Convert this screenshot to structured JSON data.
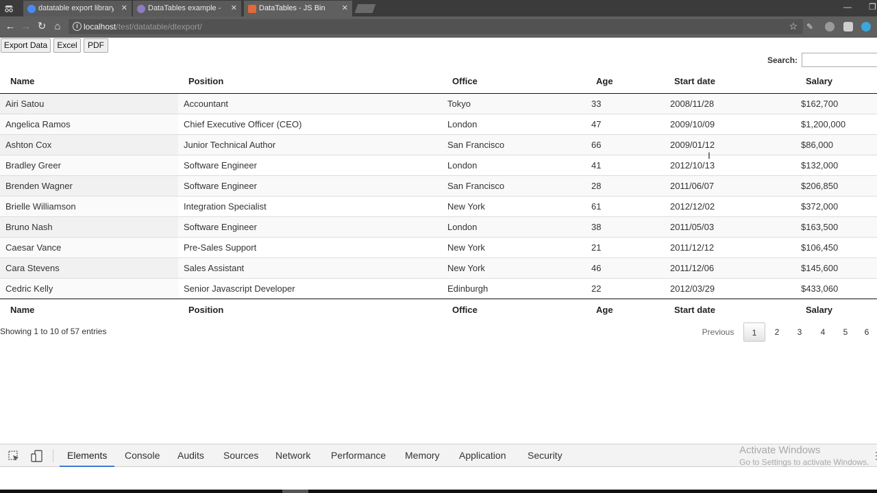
{
  "browser": {
    "tabs": [
      {
        "title": "datatable export library",
        "favicon_color": "#4a8af4"
      },
      {
        "title": "DataTables example - File",
        "favicon_color": "#8e7cc3"
      },
      {
        "title": "DataTables - JS Bin",
        "favicon_color": "#e2693a"
      }
    ],
    "close_glyph": "✕",
    "url_host": "localhost",
    "url_path": "/test/datatable/dtexport/"
  },
  "export_buttons": {
    "export_data": "Export Data",
    "excel": "Excel",
    "pdf": "PDF"
  },
  "search": {
    "label": "Search:",
    "value": ""
  },
  "table": {
    "columns": [
      "Name",
      "Position",
      "Office",
      "Age",
      "Start date",
      "Salary"
    ],
    "rows": [
      [
        "Airi Satou",
        "Accountant",
        "Tokyo",
        "33",
        "2008/11/28",
        "$162,700"
      ],
      [
        "Angelica Ramos",
        "Chief Executive Officer (CEO)",
        "London",
        "47",
        "2009/10/09",
        "$1,200,000"
      ],
      [
        "Ashton Cox",
        "Junior Technical Author",
        "San Francisco",
        "66",
        "2009/01/12",
        "$86,000"
      ],
      [
        "Bradley Greer",
        "Software Engineer",
        "London",
        "41",
        "2012/10/13",
        "$132,000"
      ],
      [
        "Brenden Wagner",
        "Software Engineer",
        "San Francisco",
        "28",
        "2011/06/07",
        "$206,850"
      ],
      [
        "Brielle Williamson",
        "Integration Specialist",
        "New York",
        "61",
        "2012/12/02",
        "$372,000"
      ],
      [
        "Bruno Nash",
        "Software Engineer",
        "London",
        "38",
        "2011/05/03",
        "$163,500"
      ],
      [
        "Caesar Vance",
        "Pre-Sales Support",
        "New York",
        "21",
        "2011/12/12",
        "$106,450"
      ],
      [
        "Cara Stevens",
        "Sales Assistant",
        "New York",
        "46",
        "2011/12/06",
        "$145,600"
      ],
      [
        "Cedric Kelly",
        "Senior Javascript Developer",
        "Edinburgh",
        "22",
        "2012/03/29",
        "$433,060"
      ]
    ]
  },
  "info": "Showing 1 to 10 of 57 entries",
  "pagination": {
    "previous": "Previous",
    "pages": [
      "1",
      "2",
      "3",
      "4",
      "5",
      "6"
    ],
    "current": "1"
  },
  "devtools": {
    "tabs": [
      "Elements",
      "Console",
      "Audits",
      "Sources",
      "Network",
      "Performance",
      "Memory",
      "Application",
      "Security"
    ],
    "active_tab": "Elements"
  },
  "watermark": {
    "title": "Activate Windows",
    "subtitle": "Go to Settings to activate Windows."
  }
}
